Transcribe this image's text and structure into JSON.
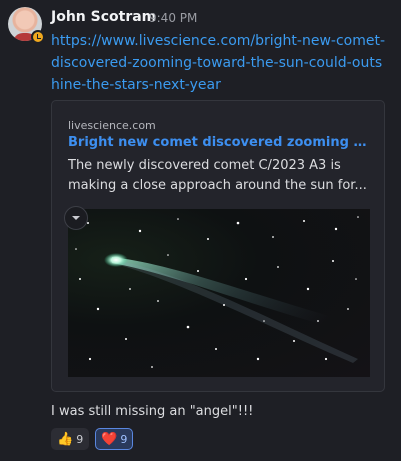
{
  "message": {
    "author": "John Scotram",
    "time": "9:40 PM",
    "link": "https://www.livescience.com/bright-new-comet-discovered-zooming-toward-the-sun-could-outshine-the-stars-next-year",
    "text": "I was still missing an \"angel\"!!!"
  },
  "embed": {
    "site": "livescience.com",
    "title": "Bright new comet discovered zooming to...",
    "description": "The newly discovered comet C/2023 A3 is making a close approach around the sun for..."
  },
  "reactions": [
    {
      "emoji": "👍",
      "count": "9",
      "active": false
    },
    {
      "emoji": "❤️",
      "count": "9",
      "active": true
    }
  ],
  "colors": {
    "link": "#3b9bf0",
    "embed_title": "#3d8ff0",
    "status_badge": "#f0a81e",
    "background": "#1e1f25"
  },
  "icons": {
    "status": "clock-badge-icon",
    "collapse": "chevron-down-icon"
  }
}
